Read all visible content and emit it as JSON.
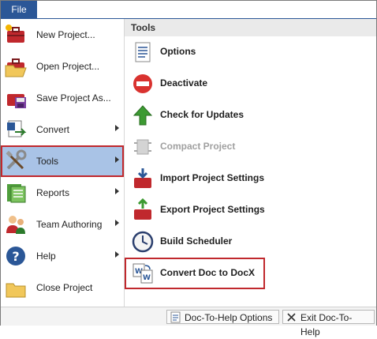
{
  "file_tab": "File",
  "menu": {
    "items": [
      {
        "label": "New Project...",
        "icon": "new-project-icon"
      },
      {
        "label": "Open Project...",
        "icon": "open-project-icon"
      },
      {
        "label": "Save Project As...",
        "icon": "save-project-icon"
      },
      {
        "label": "Convert",
        "icon": "convert-icon"
      },
      {
        "label": "Tools",
        "icon": "tools-icon"
      },
      {
        "label": "Reports",
        "icon": "reports-icon"
      },
      {
        "label": "Team Authoring",
        "icon": "team-authoring-icon"
      },
      {
        "label": "Help",
        "icon": "help-icon"
      },
      {
        "label": "Close Project",
        "icon": "close-project-icon"
      }
    ],
    "selected": "Tools"
  },
  "tools_pane": {
    "heading": "Tools",
    "items": [
      {
        "label": "Options",
        "icon": "options-icon"
      },
      {
        "label": "Deactivate",
        "icon": "deactivate-icon"
      },
      {
        "label": "Check for Updates",
        "icon": "check-updates-icon"
      },
      {
        "label": "Compact Project",
        "icon": "compact-project-icon",
        "disabled": true
      },
      {
        "label": "Import Project Settings",
        "icon": "import-settings-icon"
      },
      {
        "label": "Export Project Settings",
        "icon": "export-settings-icon"
      },
      {
        "label": "Build Scheduler",
        "icon": "build-scheduler-icon"
      },
      {
        "label": "Convert Doc to DocX",
        "icon": "convert-doc-icon"
      }
    ]
  },
  "footer": {
    "options_label": "Doc-To-Help Options",
    "exit_label": "Exit Doc-To-Help"
  },
  "colors": {
    "file_tab": "#2b5797",
    "selected_bg": "#a9c3e6",
    "highlight_border": "#c0282d"
  }
}
